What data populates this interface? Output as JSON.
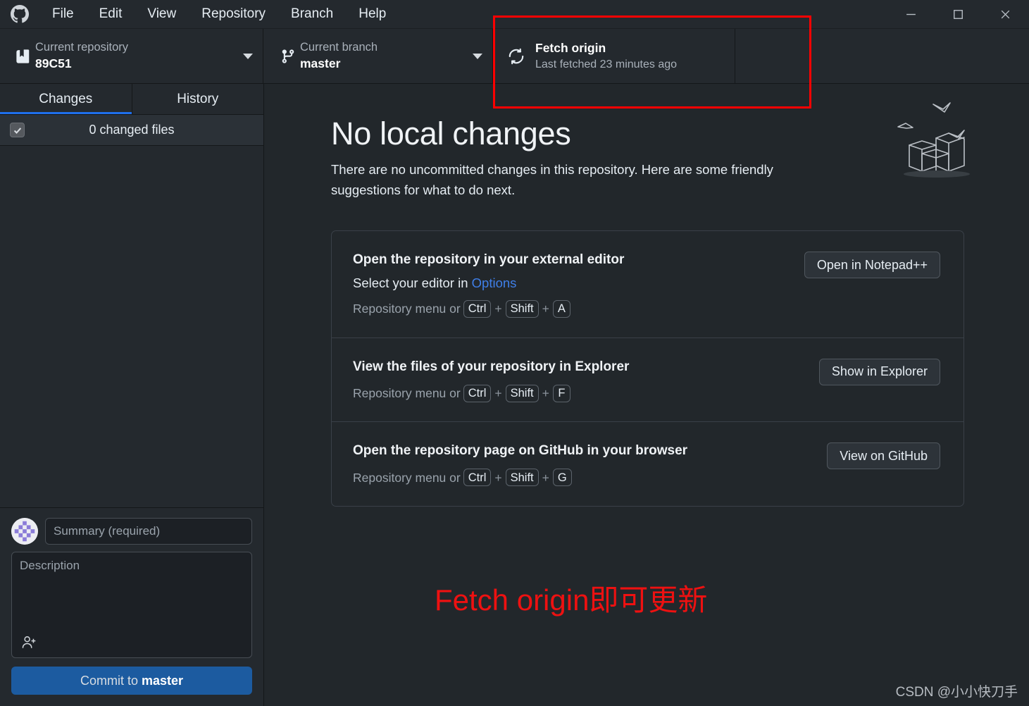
{
  "window": {
    "app_logo_icon": "github-mark-icon",
    "minimize_icon": "minimize-icon",
    "maximize_icon": "maximize-icon",
    "close_icon": "close-icon"
  },
  "menubar": {
    "items": [
      {
        "label": "File"
      },
      {
        "label": "Edit"
      },
      {
        "label": "View"
      },
      {
        "label": "Repository"
      },
      {
        "label": "Branch"
      },
      {
        "label": "Help"
      }
    ]
  },
  "toolbar": {
    "repository": {
      "icon": "repo-icon",
      "label": "Current repository",
      "value": "89C51",
      "caret_icon": "chevron-down-icon"
    },
    "branch": {
      "icon": "git-branch-icon",
      "label": "Current branch",
      "value": "master",
      "caret_icon": "chevron-down-icon"
    },
    "fetch": {
      "icon": "sync-icon",
      "title": "Fetch origin",
      "subtitle": "Last fetched 23 minutes ago"
    }
  },
  "sidebar": {
    "tabs": [
      {
        "label": "Changes",
        "active": true
      },
      {
        "label": "History",
        "active": false
      }
    ],
    "changed_files": {
      "checkbox_icon": "check-icon",
      "label": "0 changed files"
    },
    "commit": {
      "avatar": "user-avatar",
      "summary_placeholder": "Summary (required)",
      "summary_value": "",
      "description_placeholder": "Description",
      "description_value": "",
      "coauthor_icon": "add-person-icon",
      "button_prefix": "Commit to ",
      "button_branch": "master"
    }
  },
  "main": {
    "illustration_icon": "empty-boxes-illustration",
    "title": "No local changes",
    "description": "There are no uncommitted changes in this repository. Here are some friendly suggestions for what to do next.",
    "cards": [
      {
        "title": "Open the repository in your external editor",
        "subtitle_prefix": "Select your editor in ",
        "subtitle_link": "Options",
        "menu_prefix": "Repository menu or",
        "keys": [
          "Ctrl",
          "Shift",
          "A"
        ],
        "button": "Open in Notepad++"
      },
      {
        "title": "View the files of your repository in Explorer",
        "subtitle_prefix": "",
        "subtitle_link": "",
        "menu_prefix": "Repository menu or",
        "keys": [
          "Ctrl",
          "Shift",
          "F"
        ],
        "button": "Show in Explorer"
      },
      {
        "title": "Open the repository page on GitHub in your browser",
        "subtitle_prefix": "",
        "subtitle_link": "",
        "menu_prefix": "Repository menu or",
        "keys": [
          "Ctrl",
          "Shift",
          "G"
        ],
        "button": "View on GitHub"
      }
    ]
  },
  "annotations": {
    "text": "Fetch origin即可更新",
    "color": "#ee1111",
    "box_color": "#ff0000"
  },
  "watermark": {
    "text": "CSDN @小小快刀手"
  }
}
